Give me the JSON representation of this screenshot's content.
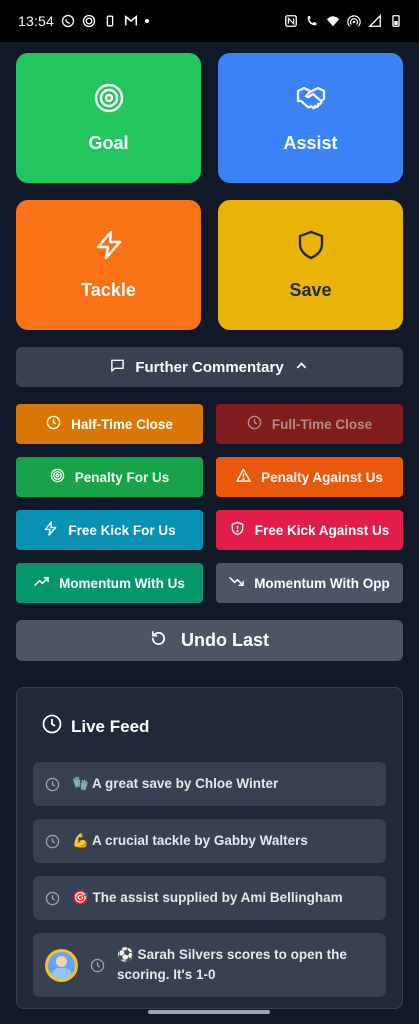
{
  "status_bar": {
    "time": "13:54",
    "left_icons": [
      "whatsapp-icon",
      "nfc-circle-icon",
      "battery-small-icon",
      "gmail-icon"
    ],
    "right_icons": [
      "nfc-icon",
      "wifi-calling-icon",
      "wifi-icon",
      "hotspot-icon",
      "signal-icon",
      "battery-icon"
    ]
  },
  "actions": {
    "goal": "Goal",
    "assist": "Assist",
    "tackle": "Tackle",
    "save": "Save"
  },
  "commentary": {
    "label": "Further Commentary"
  },
  "commentary_buttons": {
    "half_time_close": "Half-Time Close",
    "full_time_close": "Full-Time Close",
    "penalty_for_us": "Penalty For Us",
    "penalty_against_us": "Penalty Against Us",
    "free_kick_for_us": "Free Kick For Us",
    "free_kick_against_us": "Free Kick Against Us",
    "momentum_with_us": "Momentum With Us",
    "momentum_with_opp": "Momentum With Opp"
  },
  "undo": {
    "label": "Undo Last"
  },
  "feed": {
    "title": "Live Feed",
    "items": [
      {
        "text": "🧤 A great save by Chloe Winter"
      },
      {
        "text": "💪 A crucial tackle by Gabby Walters"
      },
      {
        "text": "🎯 The assist supplied by Ami Bellingham"
      },
      {
        "text": "⚽ Sarah Silvers scores to open the scoring. It's 1-0"
      }
    ]
  },
  "colors": {
    "background": "#111827",
    "goal": "#22c55e",
    "assist": "#3b82f6",
    "tackle": "#f97316",
    "save": "#eab308"
  }
}
